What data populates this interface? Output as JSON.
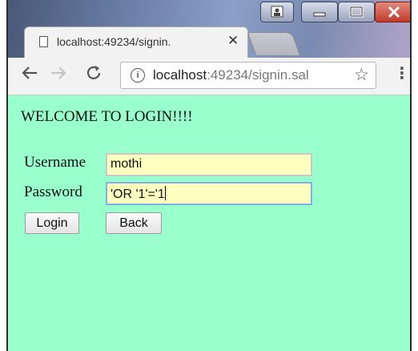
{
  "browser": {
    "tab_title": "localhost:49234/signin.",
    "tab_close": "✕",
    "url_host": "localhost",
    "url_rest": ":49234/signin.sal",
    "info_glyph": "i",
    "back_icon": "arrow-left-icon",
    "forward_icon": "arrow-right-icon",
    "reload_icon": "reload-icon",
    "star_icon": "star-icon",
    "menu_icon": "vertical-dots-icon"
  },
  "page": {
    "background": "#99ffcc",
    "welcome": "WELCOME TO LOGIN!!!!",
    "username_label": "Username",
    "username_value": "mothi",
    "password_label": "Password",
    "password_value": "'OR '1'='1",
    "login_button": "Login",
    "back_button": "Back"
  }
}
